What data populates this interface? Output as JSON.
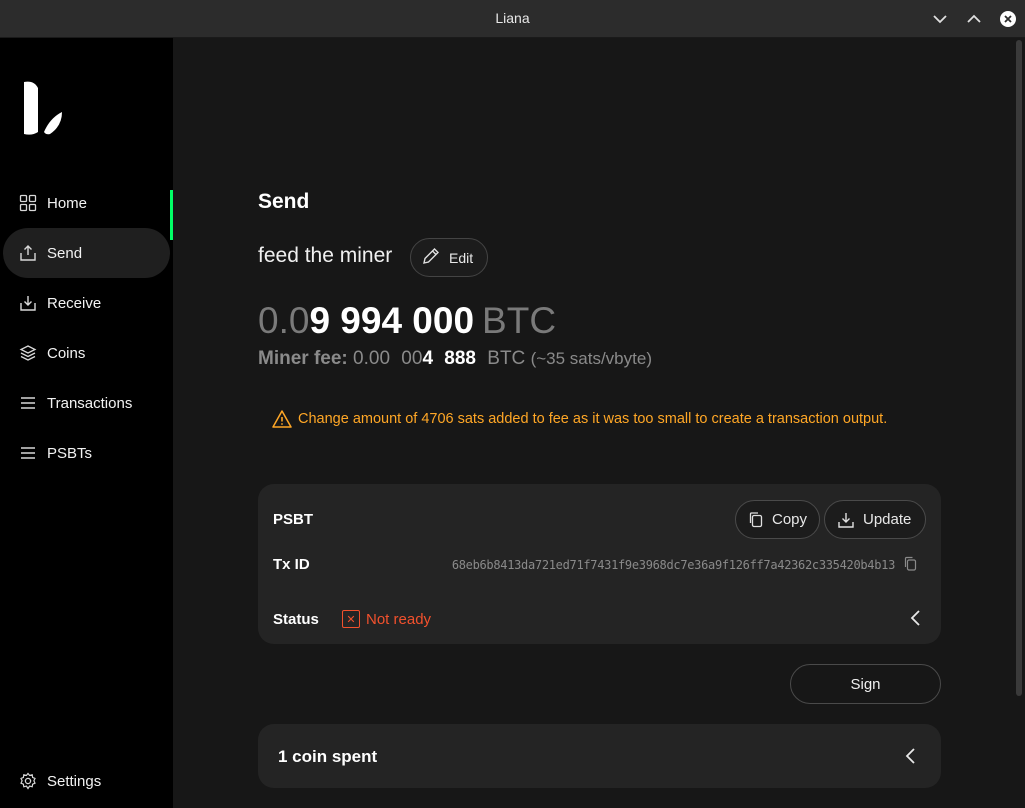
{
  "window": {
    "title": "Liana"
  },
  "sidebar": {
    "items": [
      {
        "label": "Home",
        "icon": "grid-icon"
      },
      {
        "label": "Send",
        "icon": "send-icon",
        "active": true
      },
      {
        "label": "Receive",
        "icon": "receive-icon"
      },
      {
        "label": "Coins",
        "icon": "coins-icon"
      },
      {
        "label": "Transactions",
        "icon": "list-icon"
      },
      {
        "label": "PSBTs",
        "icon": "list-icon"
      }
    ],
    "settings_label": "Settings",
    "accent": "#00ff66"
  },
  "main": {
    "title": "Send",
    "description": "feed the miner",
    "edit_label": "Edit",
    "amount": {
      "dim": "0.0",
      "strong": "9 994 000",
      "unit": "BTC"
    },
    "fee": {
      "label": "Miner fee:",
      "dim1": "0.00",
      "dim2": "00",
      "strong1": "4",
      "strong2": "888",
      "unit": "BTC",
      "rate": "(~35 sats/vbyte)"
    },
    "warning": "Change amount of 4706 sats added to fee as it was too small to create a transaction output.",
    "warning_color": "#ffa726",
    "psbt": {
      "label": "PSBT",
      "copy_label": "Copy",
      "update_label": "Update",
      "txid_label": "Tx ID",
      "txid": "68eb6b8413da721ed71f7431f9e3968dc7e36a9f126ff7a42362c335420b4b13",
      "status_label": "Status",
      "status_value": "Not ready",
      "status_color": "#f2512d"
    },
    "sign_label": "Sign",
    "coins_spent": "1 coin spent"
  }
}
